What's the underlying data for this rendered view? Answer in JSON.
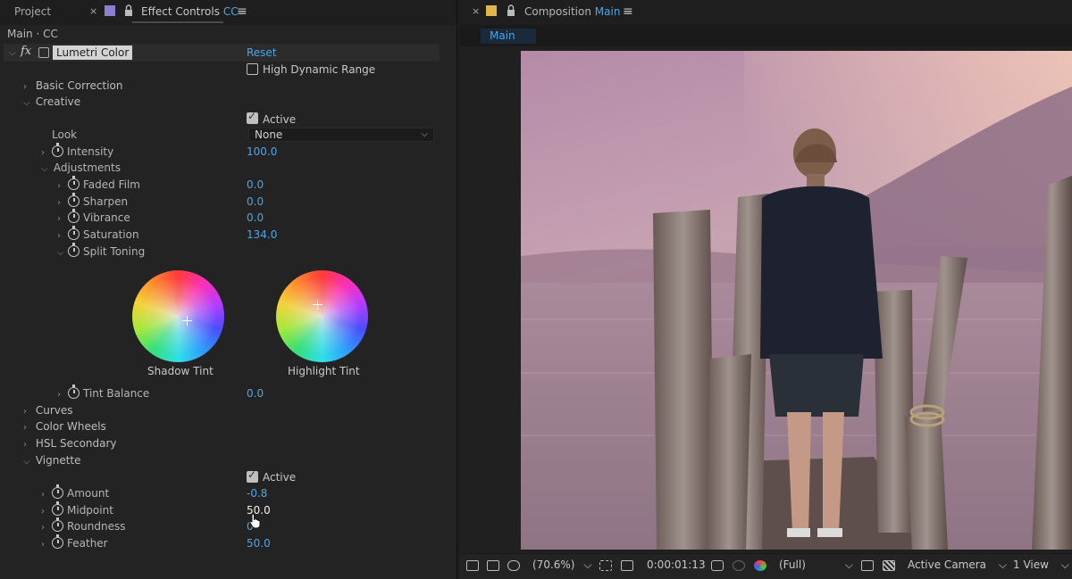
{
  "left_panel": {
    "tabs": {
      "project": "Project",
      "close": "×",
      "effect_controls": "Effect Controls",
      "effect_controls_target": "CC",
      "menu": "≡"
    },
    "subheader": "Main · CC",
    "effect": {
      "fx": "fx",
      "name": "Lumetri Color",
      "reset": "Reset",
      "hdr_label": "High Dynamic Range"
    },
    "sections": {
      "basic_correction": "Basic Correction",
      "creative": "Creative",
      "curves": "Curves",
      "color_wheels": "Color Wheels",
      "hsl_secondary": "HSL Secondary",
      "vignette": "Vignette"
    },
    "creative": {
      "active_label": "Active",
      "look_label": "Look",
      "look_value": "None",
      "intensity_label": "Intensity",
      "intensity_value": "100.0",
      "adjustments_label": "Adjustments",
      "faded_film_label": "Faded Film",
      "faded_film_value": "0.0",
      "sharpen_label": "Sharpen",
      "sharpen_value": "0.0",
      "vibrance_label": "Vibrance",
      "vibrance_value": "0.0",
      "saturation_label": "Saturation",
      "saturation_value": "134.0",
      "split_toning_label": "Split Toning",
      "shadow_tint_label": "Shadow Tint",
      "highlight_tint_label": "Highlight Tint",
      "tint_balance_label": "Tint Balance",
      "tint_balance_value": "0.0"
    },
    "vignette": {
      "active_label": "Active",
      "amount_label": "Amount",
      "amount_value": "-0.8",
      "midpoint_label": "Midpoint",
      "midpoint_value": "50.0",
      "roundness_label": "Roundness",
      "roundness_value": "0",
      "feather_label": "Feather",
      "feather_value": "50.0"
    }
  },
  "right_panel": {
    "tabs": {
      "close": "×",
      "composition_label": "Composition",
      "composition_name": "Main",
      "menu": "≡"
    },
    "viewer_tab": "Main",
    "toolbar": {
      "zoom": "(70.6%)",
      "timecode": "0:00:01:13",
      "resolution": "(Full)",
      "camera": "Active Camera",
      "views": "1 View"
    }
  },
  "colors": {
    "accent_blue": "#4aa6e8",
    "panel_bg": "#232323",
    "header_bg": "#1e1e1e"
  }
}
